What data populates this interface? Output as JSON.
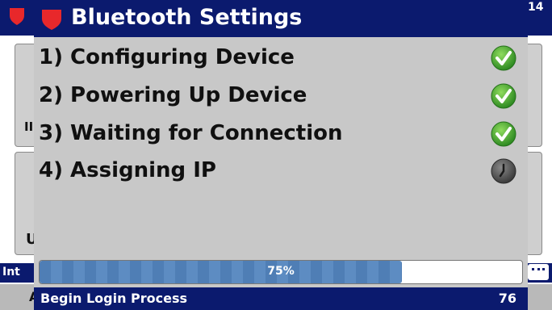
{
  "background": {
    "corner_number": "14",
    "left_fragment_1": "II",
    "left_fragment_2": "U",
    "info_bar_label": "Int",
    "bottom_fragment": "A",
    "icons": {
      "shield": "shield-icon",
      "keyboard": "keyboard-icon"
    }
  },
  "dialog": {
    "title": "Bluetooth Settings",
    "title_icon": "shield-icon",
    "steps": [
      {
        "label": "1) Configuring Device",
        "status": "done",
        "status_icon": "checkmark-icon"
      },
      {
        "label": "2) Powering Up Device",
        "status": "done",
        "status_icon": "checkmark-icon"
      },
      {
        "label": "3) Waiting for Connection",
        "status": "done",
        "status_icon": "checkmark-icon"
      },
      {
        "label": "4) Assigning IP",
        "status": "pending",
        "status_icon": "clock-icon"
      }
    ],
    "progress": {
      "value": 0.75,
      "text": "75%"
    },
    "status_bar": {
      "text": "Begin Login Process",
      "count": "76"
    }
  },
  "colors": {
    "title_bar": "#0b1a6e",
    "dialog_bg": "#c8c8c8",
    "shield_red": "#e8282b",
    "check_green": "#3aa12c",
    "progress_fill": "#4f7eb5"
  }
}
